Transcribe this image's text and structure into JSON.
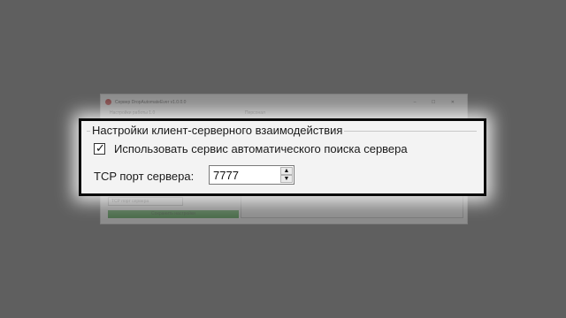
{
  "background_window": {
    "title": "Сервер DropAutomateEver v1.0.0.0",
    "controls": "–  ☐  ✕",
    "tab_left": "Настройки работы 1.0",
    "tab_right": "Персонал",
    "combo_value": "TCP порт сервера",
    "green_button_label": "Сохранить настройки"
  },
  "group": {
    "title": "Настройки клиент-серверного взаимодействия",
    "auto_discovery": {
      "label": "Использовать сервис автоматического поиска сервера",
      "checked": true,
      "check_glyph": "✓"
    },
    "tcp_port": {
      "label": "TCP порт сервера:",
      "value": "7777",
      "up_glyph": "▲",
      "down_glyph": "▼"
    }
  },
  "colors": {
    "backdrop": "#5f5f5f",
    "panel": "#f3f3f3",
    "highlight_border": "#0a0a0a",
    "green": "#1a8f1a"
  }
}
